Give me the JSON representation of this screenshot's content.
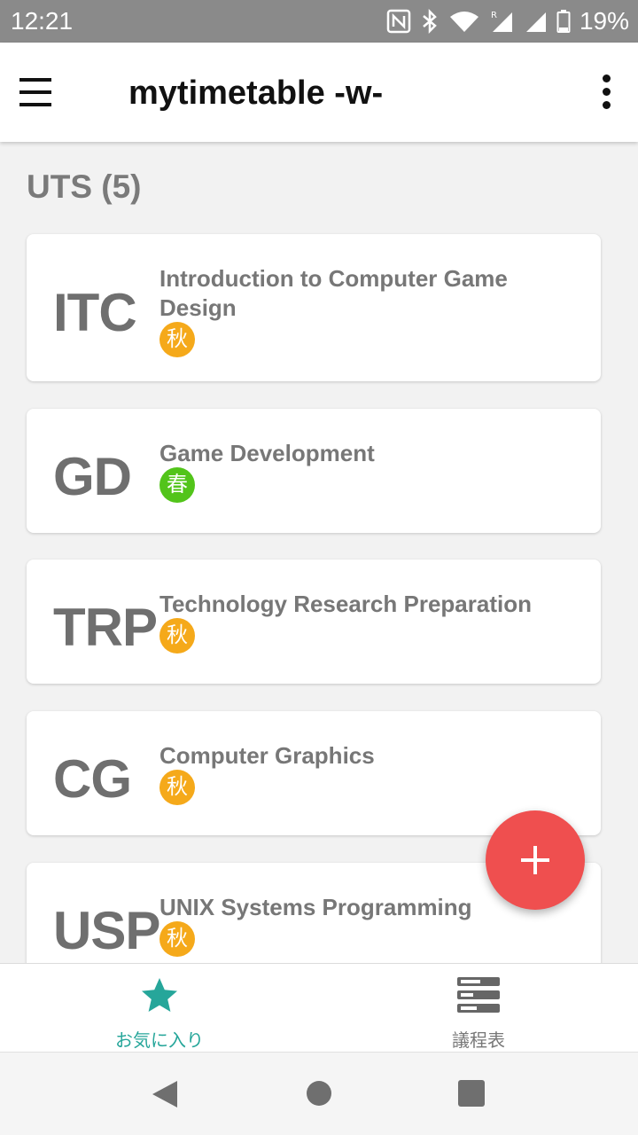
{
  "status_bar": {
    "time": "12:21",
    "battery": "19%"
  },
  "app_bar": {
    "title": "mytimetable -w-"
  },
  "section": {
    "title": "UTS (5)"
  },
  "courses": [
    {
      "abbr": "ITC",
      "name": "Introduction to Computer Game Design",
      "season": "秋"
    },
    {
      "abbr": "GD",
      "name": "Game Development",
      "season": "春"
    },
    {
      "abbr": "TRP",
      "name": "Technology Research Preparation",
      "season": "秋"
    },
    {
      "abbr": "CG",
      "name": "Computer Graphics",
      "season": "秋"
    },
    {
      "abbr": "USP",
      "name": "UNIX Systems Programming",
      "season": "秋"
    }
  ],
  "bottom_nav": {
    "favorites_label": "お気に入り",
    "schedule_label": "議程表"
  },
  "colors": {
    "accent_teal": "#26a69a",
    "fab_red": "#ef4f4f",
    "badge_autumn": "#f5a91a",
    "badge_spring": "#52c41a"
  }
}
